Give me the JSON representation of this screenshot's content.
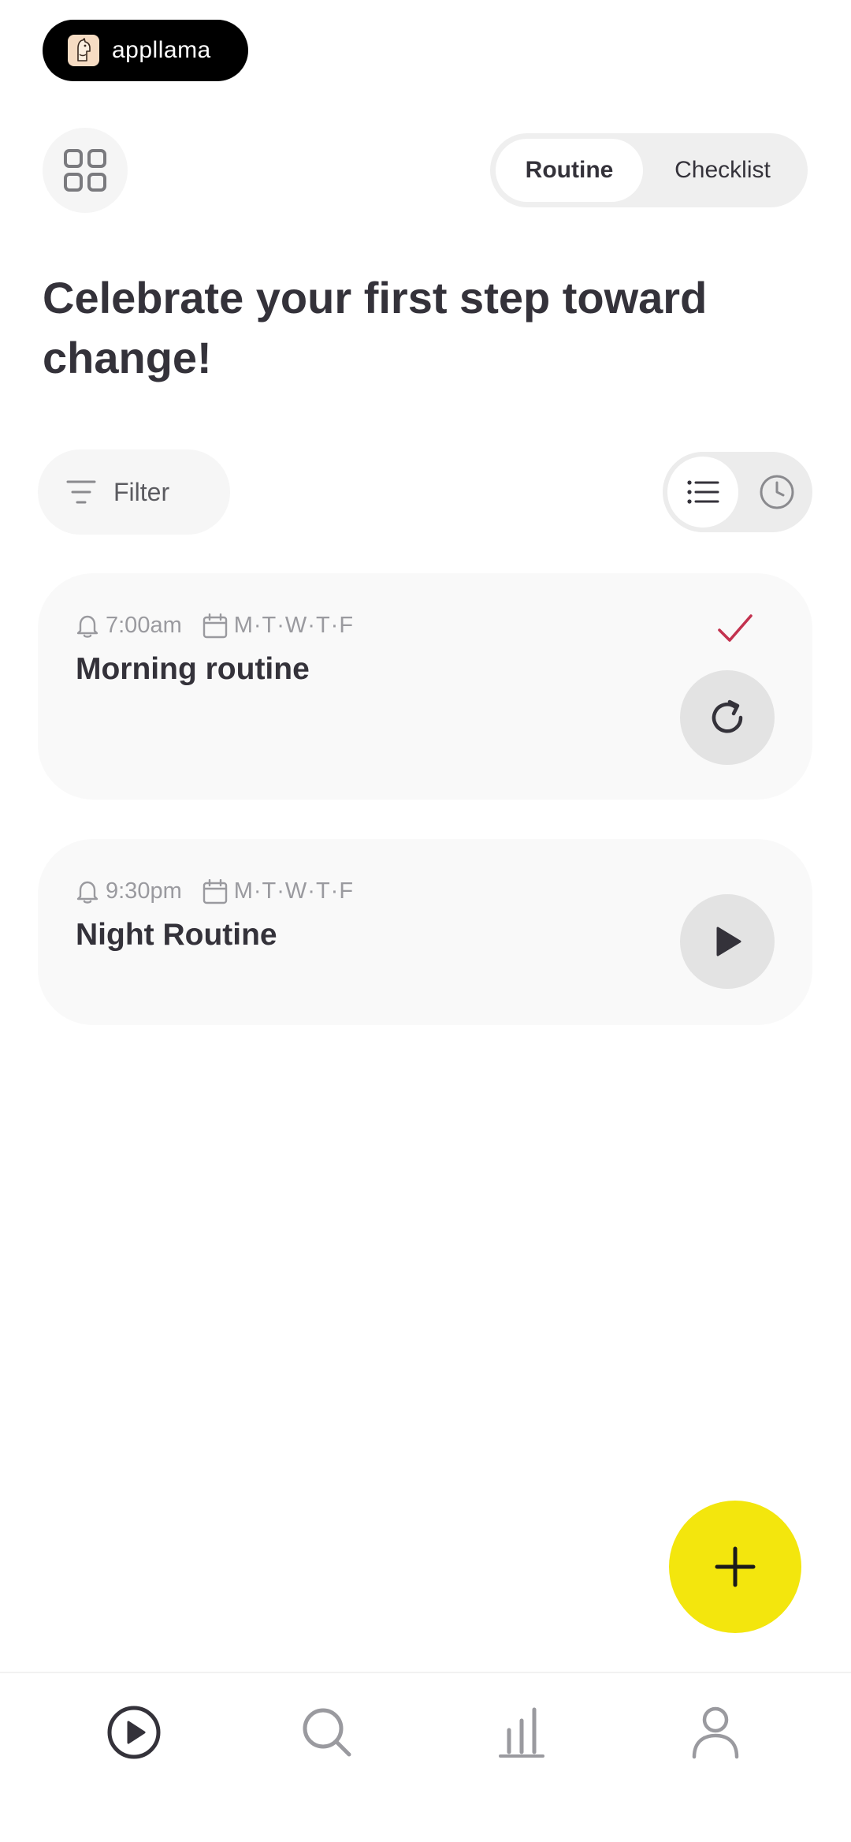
{
  "brand": {
    "name": "appllama"
  },
  "header": {
    "segments": [
      {
        "label": "Routine",
        "active": true
      },
      {
        "label": "Checklist",
        "active": false
      }
    ]
  },
  "main": {
    "title": "Celebrate your first step toward change!",
    "filter_label": "Filter",
    "view_modes": [
      "list-icon",
      "clock-icon"
    ],
    "routines": [
      {
        "time": "7:00am",
        "days": "M·T·W·T·F",
        "name": "Morning routine",
        "completed": true,
        "action_icon": "replay-icon"
      },
      {
        "time": "9:30pm",
        "days": "M·T·W·T·F",
        "name": "Night Routine",
        "completed": false,
        "action_icon": "play-icon"
      }
    ]
  },
  "colors": {
    "accent": "#f3e60d",
    "text": "#34323a",
    "check": "#c3324f",
    "muted": "#9a9a9f"
  },
  "bottom_nav": {
    "items": [
      "play-icon",
      "search-icon",
      "stats-icon",
      "profile-icon"
    ],
    "active": "play-icon"
  }
}
